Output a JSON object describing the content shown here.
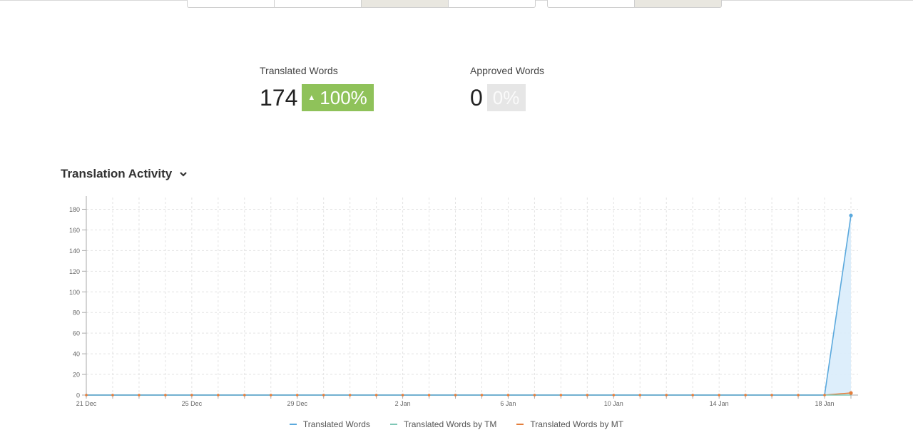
{
  "stats": {
    "translated": {
      "label": "Translated Words",
      "value": "174",
      "percent": "100%",
      "color": "#8fc25a"
    },
    "approved": {
      "label": "Approved Words",
      "value": "0",
      "percent": "0%",
      "color": "#e6e6e6"
    }
  },
  "activity": {
    "title": "Translation Activity"
  },
  "colors": {
    "translated": "#5ba9dd",
    "tm": "#7fc7b6",
    "mt": "#e47e3c",
    "area": "#d9ecfb"
  },
  "chart_data": {
    "type": "area",
    "title": "",
    "xlabel": "",
    "ylabel": "",
    "ylim": [
      0,
      190
    ],
    "y_ticks": [
      0,
      20,
      40,
      60,
      80,
      100,
      120,
      140,
      160,
      180
    ],
    "x_tick_labels": [
      "21 Dec",
      "25 Dec",
      "29 Dec",
      "2 Jan",
      "6 Jan",
      "10 Jan",
      "14 Jan",
      "18 Jan"
    ],
    "x": [
      "21 Dec",
      "22 Dec",
      "23 Dec",
      "24 Dec",
      "25 Dec",
      "26 Dec",
      "27 Dec",
      "28 Dec",
      "29 Dec",
      "30 Dec",
      "31 Dec",
      "1 Jan",
      "2 Jan",
      "3 Jan",
      "4 Jan",
      "5 Jan",
      "6 Jan",
      "7 Jan",
      "8 Jan",
      "9 Jan",
      "10 Jan",
      "11 Jan",
      "12 Jan",
      "13 Jan",
      "14 Jan",
      "15 Jan",
      "16 Jan",
      "17 Jan",
      "18 Jan",
      "19 Jan"
    ],
    "grid": true,
    "legend_position": "bottom",
    "series": [
      {
        "name": "Translated Words",
        "values": [
          0,
          0,
          0,
          0,
          0,
          0,
          0,
          0,
          0,
          0,
          0,
          0,
          0,
          0,
          0,
          0,
          0,
          0,
          0,
          0,
          0,
          0,
          0,
          0,
          0,
          0,
          0,
          0,
          0,
          174
        ]
      },
      {
        "name": "Translated Words by TM",
        "values": [
          0,
          0,
          0,
          0,
          0,
          0,
          0,
          0,
          0,
          0,
          0,
          0,
          0,
          0,
          0,
          0,
          0,
          0,
          0,
          0,
          0,
          0,
          0,
          0,
          0,
          0,
          0,
          0,
          0,
          0
        ]
      },
      {
        "name": "Translated Words by MT",
        "values": [
          0,
          0,
          0,
          0,
          0,
          0,
          0,
          0,
          0,
          0,
          0,
          0,
          0,
          0,
          0,
          0,
          0,
          0,
          0,
          0,
          0,
          0,
          0,
          0,
          0,
          0,
          0,
          0,
          0,
          2
        ]
      }
    ]
  }
}
